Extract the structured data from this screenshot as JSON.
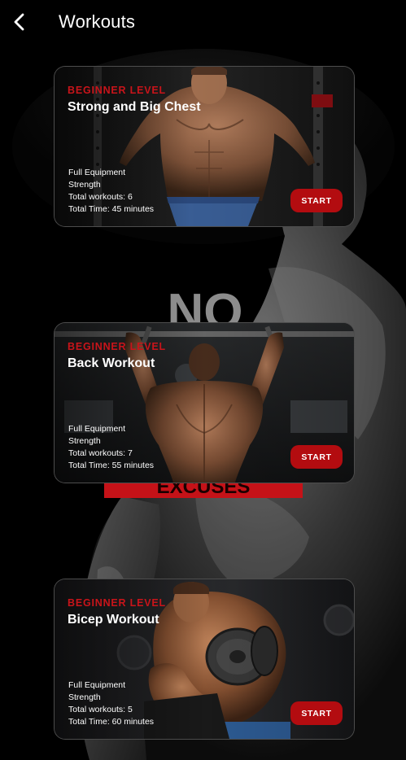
{
  "header": {
    "title": "Workouts"
  },
  "workouts": [
    {
      "level": "BEGINNER LEVEL",
      "title": "Strong and Big Chest",
      "equipment": "Full Equipment",
      "category": "Strength",
      "total_workouts": "Total workouts: 6",
      "total_time": "Total Time: 45 minutes",
      "button": "START"
    },
    {
      "level": "BEGINNER LEVEL",
      "title": "Back Workout",
      "equipment": "Full Equipment",
      "category": "Strength",
      "total_workouts": "Total workouts: 7",
      "total_time": "Total Time: 55 minutes",
      "button": "START"
    },
    {
      "level": "BEGINNER LEVEL",
      "title": "Bicep Workout",
      "equipment": "Full Equipment",
      "category": "Strength",
      "total_workouts": "Total workouts: 5",
      "total_time": "Total Time: 60 minutes",
      "button": "START"
    }
  ],
  "background": {
    "poster_top": "NO",
    "poster_bottom": "EXCUSES"
  },
  "colors": {
    "accent": "#c8141a",
    "button": "#b30c10",
    "background": "#000000"
  }
}
